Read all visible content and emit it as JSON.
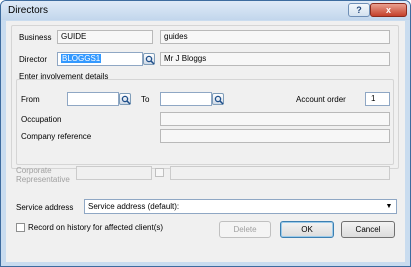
{
  "window": {
    "title": "Directors",
    "help_glyph": "?",
    "close_glyph": "x"
  },
  "business": {
    "label": "Business",
    "code": "GUIDE",
    "name": "guides"
  },
  "director": {
    "label": "Director",
    "code": "BLOGGS1",
    "name": "Mr J Bloggs"
  },
  "involvement": {
    "heading": "Enter involvement details",
    "from_label": "From",
    "from_value": "",
    "to_label": "To",
    "to_value": "",
    "account_order_label": "Account order",
    "account_order_value": "1",
    "occupation_label": "Occupation",
    "occupation_value": "",
    "company_reference_label": "Company reference",
    "company_reference_value": ""
  },
  "corporate": {
    "label_line1": "Corporate",
    "label_line2": "Representative"
  },
  "service_address": {
    "label": "Service address",
    "selected": "Service address (default):"
  },
  "record_history": {
    "label": "Record on history for affected client(s)",
    "checked": false
  },
  "buttons": {
    "delete": "Delete",
    "ok": "OK",
    "cancel": "Cancel"
  }
}
